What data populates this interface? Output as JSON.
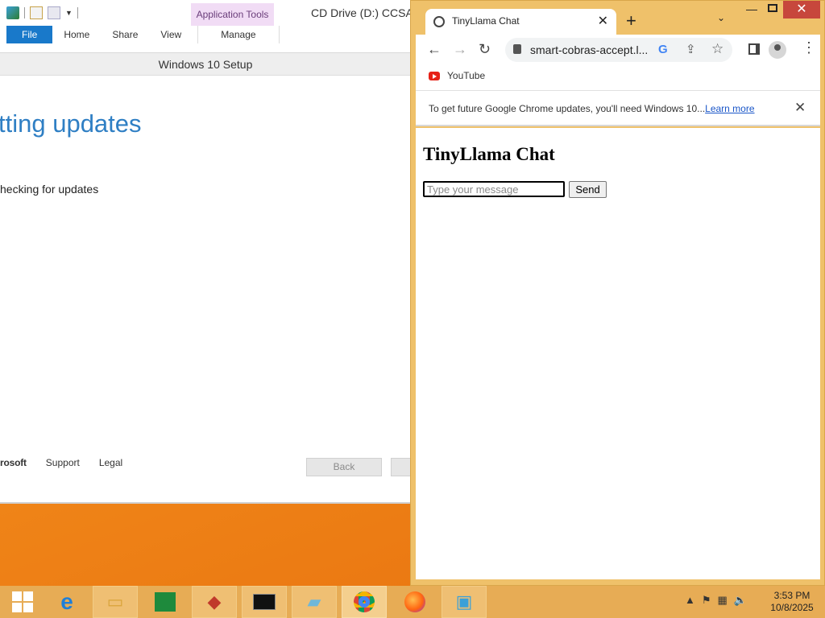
{
  "explorer": {
    "title": "CD Drive (D:) CCSA",
    "app_tools": "Application Tools",
    "tabs": [
      "File",
      "Home",
      "Share",
      "View",
      "Manage"
    ]
  },
  "setup": {
    "window_title": "Windows 10 Setup",
    "heading": "tting updates",
    "status": "hecking for updates",
    "footer": {
      "brand": "rosoft",
      "support": "Support",
      "legal": "Legal"
    },
    "back_label": "Back"
  },
  "chrome": {
    "tab_title": "TinyLlama Chat",
    "url": "smart-cobras-accept.l...",
    "bookmark": "YouTube",
    "infobar_message": "To get future Google Chrome updates, you'll need Windows 10...",
    "infobar_link": "Learn more",
    "page": {
      "heading": "TinyLlama Chat",
      "input_placeholder": "Type your message",
      "send_label": "Send"
    }
  },
  "taskbar": {
    "time": "3:53 PM",
    "date": "10/8/2025",
    "items": [
      "start",
      "internet-explorer",
      "file-explorer",
      "store",
      "filezilla",
      "cmd",
      "notepad",
      "chrome",
      "firefox",
      "setup"
    ]
  },
  "colors": {
    "accent": "#2f7fc4",
    "chrome_frame": "#efc16a",
    "taskbar": "#e7ac55"
  }
}
